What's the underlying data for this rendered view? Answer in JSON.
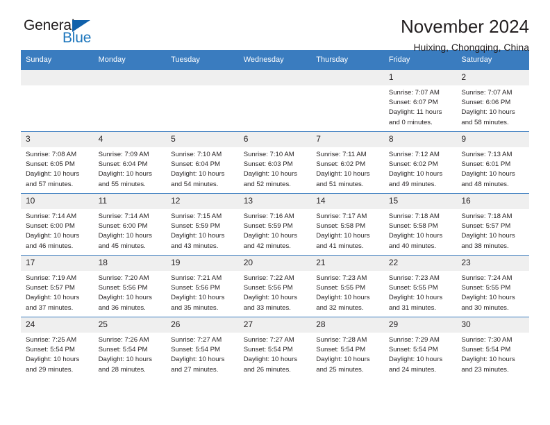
{
  "brand": {
    "name_part1": "General",
    "name_part2": "Blue",
    "triangle_color": "#1061ab",
    "blue_color": "#1b75bc"
  },
  "header": {
    "title": "November 2024",
    "location": "Huixing, Chongqing, China",
    "header_bg": "#3a7cbf",
    "daynum_bg": "#efefef"
  },
  "weekdays": [
    "Sunday",
    "Monday",
    "Tuesday",
    "Wednesday",
    "Thursday",
    "Friday",
    "Saturday"
  ],
  "weeks": [
    [
      {
        "day": "",
        "empty": true
      },
      {
        "day": "",
        "empty": true
      },
      {
        "day": "",
        "empty": true
      },
      {
        "day": "",
        "empty": true
      },
      {
        "day": "",
        "empty": true
      },
      {
        "day": "1",
        "sunrise": "Sunrise: 7:07 AM",
        "sunset": "Sunset: 6:07 PM",
        "daylight": "Daylight: 11 hours and 0 minutes."
      },
      {
        "day": "2",
        "sunrise": "Sunrise: 7:07 AM",
        "sunset": "Sunset: 6:06 PM",
        "daylight": "Daylight: 10 hours and 58 minutes."
      }
    ],
    [
      {
        "day": "3",
        "sunrise": "Sunrise: 7:08 AM",
        "sunset": "Sunset: 6:05 PM",
        "daylight": "Daylight: 10 hours and 57 minutes."
      },
      {
        "day": "4",
        "sunrise": "Sunrise: 7:09 AM",
        "sunset": "Sunset: 6:04 PM",
        "daylight": "Daylight: 10 hours and 55 minutes."
      },
      {
        "day": "5",
        "sunrise": "Sunrise: 7:10 AM",
        "sunset": "Sunset: 6:04 PM",
        "daylight": "Daylight: 10 hours and 54 minutes."
      },
      {
        "day": "6",
        "sunrise": "Sunrise: 7:10 AM",
        "sunset": "Sunset: 6:03 PM",
        "daylight": "Daylight: 10 hours and 52 minutes."
      },
      {
        "day": "7",
        "sunrise": "Sunrise: 7:11 AM",
        "sunset": "Sunset: 6:02 PM",
        "daylight": "Daylight: 10 hours and 51 minutes."
      },
      {
        "day": "8",
        "sunrise": "Sunrise: 7:12 AM",
        "sunset": "Sunset: 6:02 PM",
        "daylight": "Daylight: 10 hours and 49 minutes."
      },
      {
        "day": "9",
        "sunrise": "Sunrise: 7:13 AM",
        "sunset": "Sunset: 6:01 PM",
        "daylight": "Daylight: 10 hours and 48 minutes."
      }
    ],
    [
      {
        "day": "10",
        "sunrise": "Sunrise: 7:14 AM",
        "sunset": "Sunset: 6:00 PM",
        "daylight": "Daylight: 10 hours and 46 minutes."
      },
      {
        "day": "11",
        "sunrise": "Sunrise: 7:14 AM",
        "sunset": "Sunset: 6:00 PM",
        "daylight": "Daylight: 10 hours and 45 minutes."
      },
      {
        "day": "12",
        "sunrise": "Sunrise: 7:15 AM",
        "sunset": "Sunset: 5:59 PM",
        "daylight": "Daylight: 10 hours and 43 minutes."
      },
      {
        "day": "13",
        "sunrise": "Sunrise: 7:16 AM",
        "sunset": "Sunset: 5:59 PM",
        "daylight": "Daylight: 10 hours and 42 minutes."
      },
      {
        "day": "14",
        "sunrise": "Sunrise: 7:17 AM",
        "sunset": "Sunset: 5:58 PM",
        "daylight": "Daylight: 10 hours and 41 minutes."
      },
      {
        "day": "15",
        "sunrise": "Sunrise: 7:18 AM",
        "sunset": "Sunset: 5:58 PM",
        "daylight": "Daylight: 10 hours and 40 minutes."
      },
      {
        "day": "16",
        "sunrise": "Sunrise: 7:18 AM",
        "sunset": "Sunset: 5:57 PM",
        "daylight": "Daylight: 10 hours and 38 minutes."
      }
    ],
    [
      {
        "day": "17",
        "sunrise": "Sunrise: 7:19 AM",
        "sunset": "Sunset: 5:57 PM",
        "daylight": "Daylight: 10 hours and 37 minutes."
      },
      {
        "day": "18",
        "sunrise": "Sunrise: 7:20 AM",
        "sunset": "Sunset: 5:56 PM",
        "daylight": "Daylight: 10 hours and 36 minutes."
      },
      {
        "day": "19",
        "sunrise": "Sunrise: 7:21 AM",
        "sunset": "Sunset: 5:56 PM",
        "daylight": "Daylight: 10 hours and 35 minutes."
      },
      {
        "day": "20",
        "sunrise": "Sunrise: 7:22 AM",
        "sunset": "Sunset: 5:56 PM",
        "daylight": "Daylight: 10 hours and 33 minutes."
      },
      {
        "day": "21",
        "sunrise": "Sunrise: 7:23 AM",
        "sunset": "Sunset: 5:55 PM",
        "daylight": "Daylight: 10 hours and 32 minutes."
      },
      {
        "day": "22",
        "sunrise": "Sunrise: 7:23 AM",
        "sunset": "Sunset: 5:55 PM",
        "daylight": "Daylight: 10 hours and 31 minutes."
      },
      {
        "day": "23",
        "sunrise": "Sunrise: 7:24 AM",
        "sunset": "Sunset: 5:55 PM",
        "daylight": "Daylight: 10 hours and 30 minutes."
      }
    ],
    [
      {
        "day": "24",
        "sunrise": "Sunrise: 7:25 AM",
        "sunset": "Sunset: 5:54 PM",
        "daylight": "Daylight: 10 hours and 29 minutes."
      },
      {
        "day": "25",
        "sunrise": "Sunrise: 7:26 AM",
        "sunset": "Sunset: 5:54 PM",
        "daylight": "Daylight: 10 hours and 28 minutes."
      },
      {
        "day": "26",
        "sunrise": "Sunrise: 7:27 AM",
        "sunset": "Sunset: 5:54 PM",
        "daylight": "Daylight: 10 hours and 27 minutes."
      },
      {
        "day": "27",
        "sunrise": "Sunrise: 7:27 AM",
        "sunset": "Sunset: 5:54 PM",
        "daylight": "Daylight: 10 hours and 26 minutes."
      },
      {
        "day": "28",
        "sunrise": "Sunrise: 7:28 AM",
        "sunset": "Sunset: 5:54 PM",
        "daylight": "Daylight: 10 hours and 25 minutes."
      },
      {
        "day": "29",
        "sunrise": "Sunrise: 7:29 AM",
        "sunset": "Sunset: 5:54 PM",
        "daylight": "Daylight: 10 hours and 24 minutes."
      },
      {
        "day": "30",
        "sunrise": "Sunrise: 7:30 AM",
        "sunset": "Sunset: 5:54 PM",
        "daylight": "Daylight: 10 hours and 23 minutes."
      }
    ]
  ]
}
